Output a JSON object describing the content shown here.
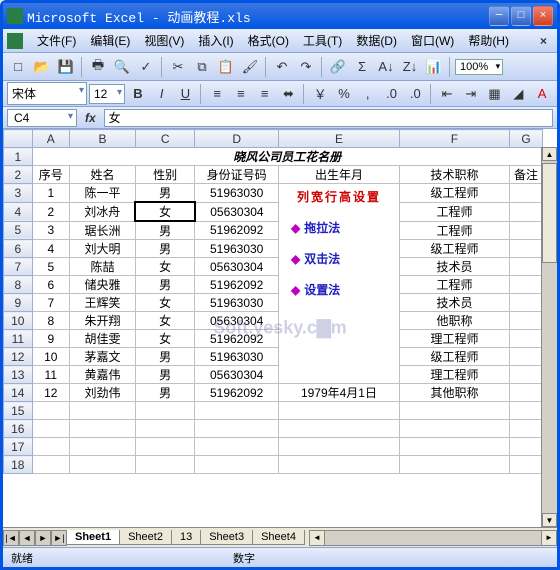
{
  "window": {
    "title": "Microsoft Excel - 动画教程.xls"
  },
  "winbtns": {
    "min": "─",
    "max": "□",
    "close": "×"
  },
  "menubar": {
    "items": [
      "文件(F)",
      "编辑(E)",
      "视图(V)",
      "插入(I)",
      "格式(O)",
      "工具(T)",
      "数据(D)",
      "窗口(W)",
      "帮助(H)"
    ]
  },
  "toolbar": {
    "zoom": "100%",
    "icons": [
      "new-icon",
      "open-icon",
      "save-icon",
      "print-icon",
      "preview-icon",
      "spell-icon",
      "cut-icon",
      "copy-icon",
      "paste-icon",
      "painter-icon",
      "undo-icon",
      "redo-icon",
      "link-icon",
      "sum-icon",
      "sort-asc-icon",
      "sort-desc-icon",
      "chart-icon"
    ]
  },
  "fmtbar": {
    "font": "宋体",
    "size": "12",
    "icons": [
      "bold-icon",
      "italic-icon",
      "underline-icon",
      "align-left-icon",
      "align-center-icon",
      "align-right-icon",
      "merge-icon",
      "currency-icon",
      "percent-icon",
      "comma-icon",
      "inc-decimal-icon",
      "dec-decimal-icon",
      "indent-out-icon",
      "indent-in-icon",
      "border-icon",
      "fill-icon",
      "font-color-icon"
    ]
  },
  "cellref": {
    "name": "C4",
    "fx": "fx",
    "formula": "女"
  },
  "cols": [
    "",
    "A",
    "B",
    "C",
    "D",
    "E",
    "F",
    "G"
  ],
  "title_row": "晓风公司员工花名册",
  "header_row": [
    "序号",
    "姓名",
    "性别",
    "身份证号码",
    "出生年月",
    "技术职称",
    "备注"
  ],
  "rows": [
    {
      "n": "1",
      "name": "陈一平",
      "sex": "男",
      "id": "51963030",
      "date": "",
      "title": "级工程师"
    },
    {
      "n": "2",
      "name": "刘冰舟",
      "sex": "女",
      "id": "05630304",
      "date": "",
      "title": "工程师"
    },
    {
      "n": "3",
      "name": "琚长洲",
      "sex": "男",
      "id": "51962092",
      "date": "",
      "title": "工程师"
    },
    {
      "n": "4",
      "name": "刘大明",
      "sex": "男",
      "id": "51963030",
      "date": "",
      "title": "级工程师"
    },
    {
      "n": "5",
      "name": "陈喆",
      "sex": "女",
      "id": "05630304",
      "date": "",
      "title": "技术员"
    },
    {
      "n": "6",
      "name": "储央雅",
      "sex": "男",
      "id": "51962092",
      "date": "",
      "title": "工程师"
    },
    {
      "n": "7",
      "name": "王辉笑",
      "sex": "女",
      "id": "51963030",
      "date": "",
      "title": "技术员"
    },
    {
      "n": "8",
      "name": "朱开翔",
      "sex": "女",
      "id": "05630304",
      "date": "",
      "title": "他职称"
    },
    {
      "n": "9",
      "name": "胡佳雯",
      "sex": "女",
      "id": "51962092",
      "date": "",
      "title": "理工程师"
    },
    {
      "n": "10",
      "name": "茅嘉文",
      "sex": "男",
      "id": "51963030",
      "date": "",
      "title": "级工程师"
    },
    {
      "n": "11",
      "name": "黄嘉伟",
      "sex": "男",
      "id": "05630304",
      "date": "",
      "title": "理工程师"
    },
    {
      "n": "12",
      "name": "刘劲伟",
      "sex": "男",
      "id": "51962092",
      "date": "1979年4月1日",
      "title": "其他职称"
    }
  ],
  "popup": {
    "title": "列宽行高设置",
    "items": [
      "拖拉法",
      "双击法",
      "设置法"
    ]
  },
  "watermark": "Soft.yesky.c▇m",
  "sheets": {
    "tabs": [
      "Sheet1",
      "Sheet2",
      "13",
      "Sheet3",
      "Sheet4"
    ],
    "active": 0
  },
  "status": {
    "ready": "就绪",
    "mode": "数字"
  }
}
